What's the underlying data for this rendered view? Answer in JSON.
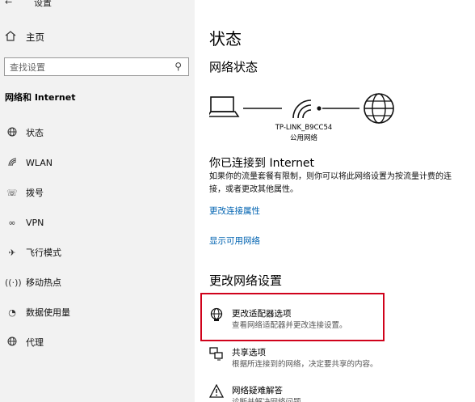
{
  "window": {
    "title": "设置"
  },
  "sidebar": {
    "home_label": "主页",
    "search_placeholder": "查找设置",
    "section_title": "网络和 Internet",
    "items": [
      {
        "label": "状态",
        "icon": "globe-icon"
      },
      {
        "label": "WLAN",
        "icon": "wifi-icon"
      },
      {
        "label": "拨号",
        "icon": "dialup-icon"
      },
      {
        "label": "VPN",
        "icon": "vpn-icon"
      },
      {
        "label": "飞行模式",
        "icon": "airplane-icon"
      },
      {
        "label": "移动热点",
        "icon": "hotspot-icon"
      },
      {
        "label": "数据使用量",
        "icon": "data-usage-icon"
      },
      {
        "label": "代理",
        "icon": "globe-icon"
      }
    ]
  },
  "main": {
    "title": "状态",
    "network_status_title": "网络状态",
    "network": {
      "ssid": "TP-LINK_B9CC54",
      "type": "公用网络"
    },
    "connected_title": "你已连接到 Internet",
    "connected_desc": "如果你的流量套餐有限制，则你可以将此网络设置为按流量计费的连接，或者更改其他属性。",
    "links": {
      "change_props": "更改连接属性",
      "show_networks": "显示可用网络"
    },
    "change_settings_title": "更改网络设置",
    "options": [
      {
        "title": "更改适配器选项",
        "desc": "查看网络适配器并更改连接设置。",
        "icon": "adapter-icon"
      },
      {
        "title": "共享选项",
        "desc": "根据所连接到的网络，决定要共享的内容。",
        "icon": "sharing-icon"
      },
      {
        "title": "网络疑难解答",
        "desc": "诊断并解决网络问题。",
        "icon": "warning-icon"
      }
    ]
  },
  "colors": {
    "link": "#0063b1",
    "highlight": "#d0021b",
    "sidebar_bg": "#f2f2f2"
  }
}
